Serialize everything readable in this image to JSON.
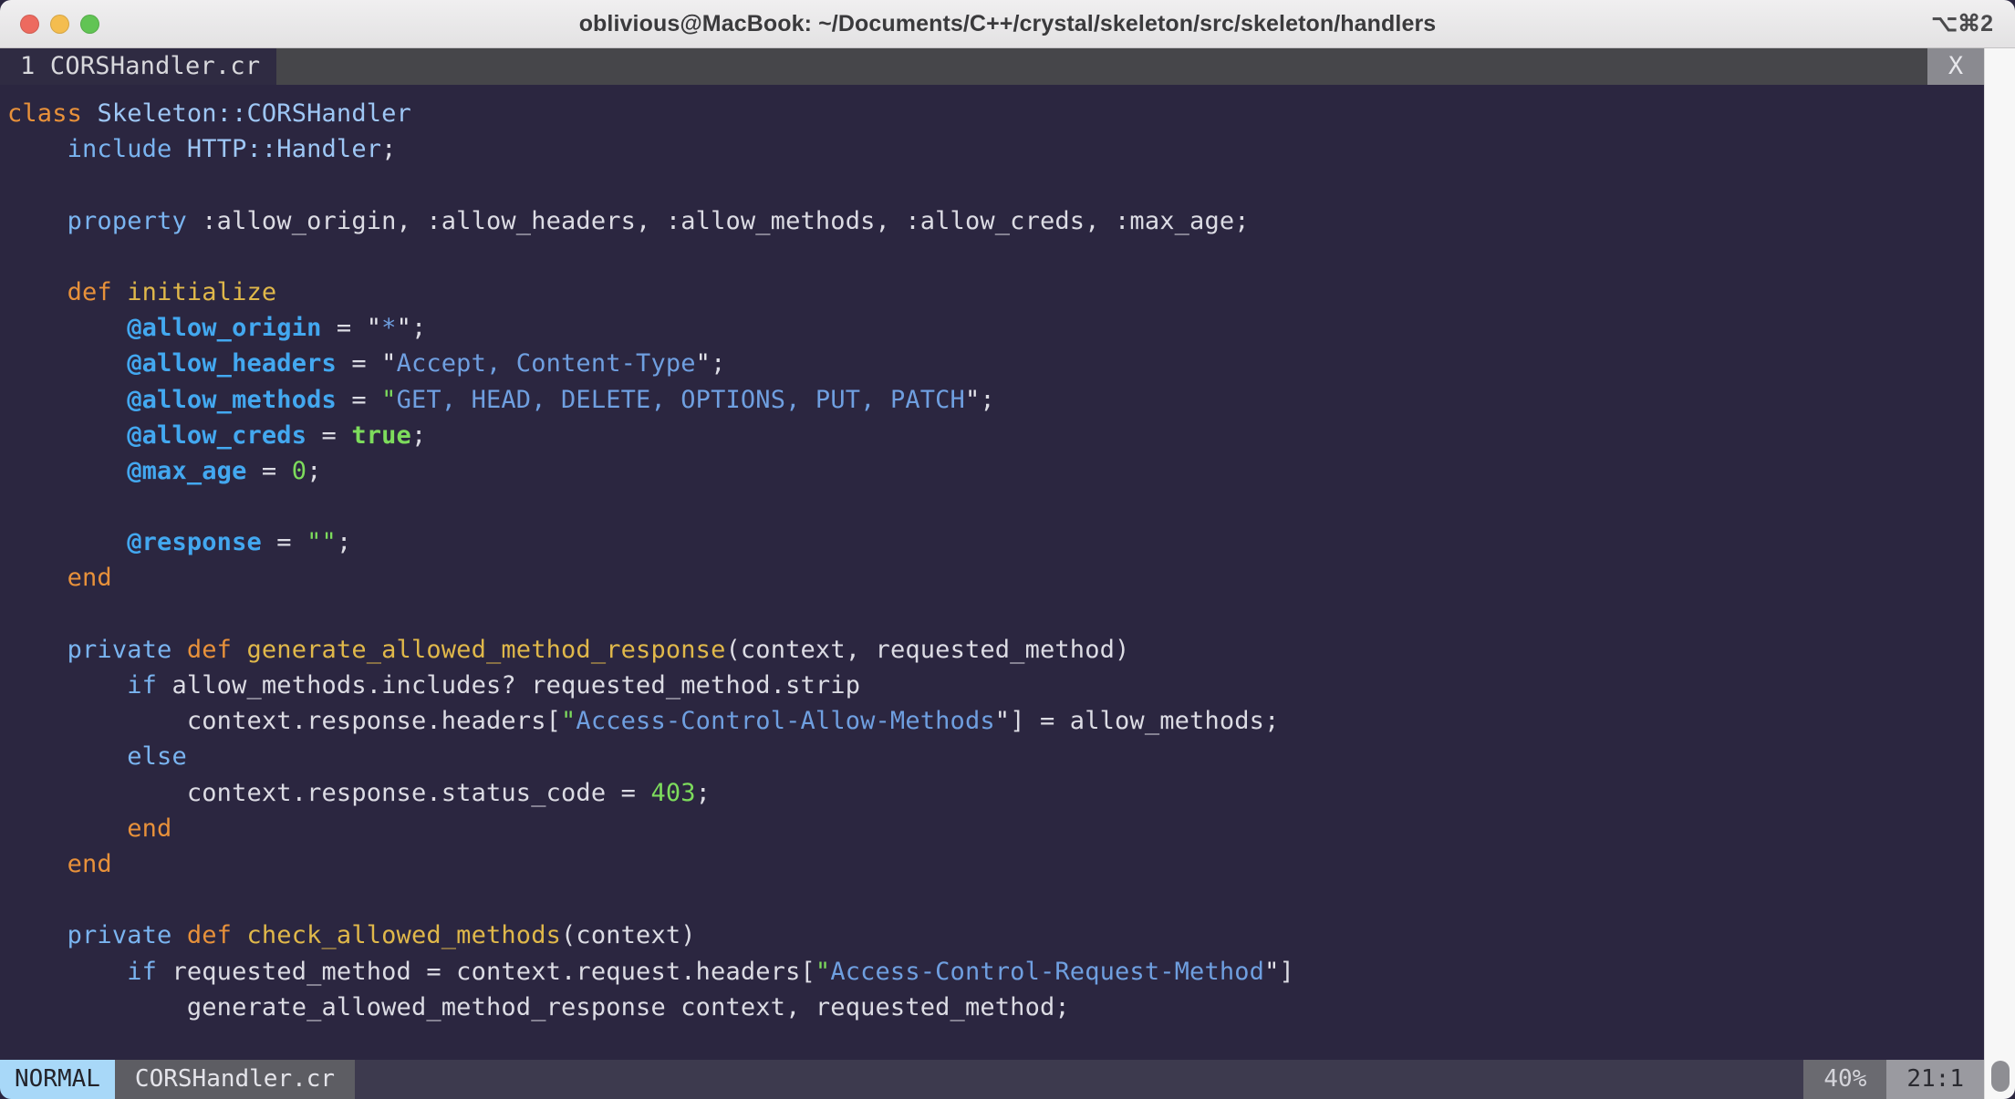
{
  "window": {
    "title": "oblivious@MacBook: ~/Documents/C++/crystal/skeleton/src/skeleton/handlers",
    "shortcut": "⌥⌘2",
    "traffic_lights": [
      "close",
      "minimize",
      "zoom"
    ]
  },
  "tabline": {
    "tabs": [
      {
        "label": "1 CORSHandler.cr"
      }
    ],
    "close_label": "X"
  },
  "statusbar": {
    "mode": "NORMAL",
    "file": "CORSHandler.cr",
    "percent": "40%",
    "position": "21:1"
  },
  "editor": {
    "language": "crystal",
    "lines": [
      [
        {
          "t": "class ",
          "c": "kw-orange"
        },
        {
          "t": "Skeleton::CORSHandler",
          "c": "typ"
        }
      ],
      [
        {
          "t": "    ",
          "c": "plain"
        },
        {
          "t": "include ",
          "c": "kw-blue"
        },
        {
          "t": "HTTP::Handler",
          "c": "typ"
        },
        {
          "t": ";",
          "c": "plain"
        }
      ],
      [],
      [
        {
          "t": "    ",
          "c": "plain"
        },
        {
          "t": "property",
          "c": "kw-blue"
        },
        {
          "t": " :allow_origin, :allow_headers, :allow_methods, :allow_creds, :max_age;",
          "c": "sym"
        }
      ],
      [],
      [
        {
          "t": "    ",
          "c": "plain"
        },
        {
          "t": "def ",
          "c": "kw-orange"
        },
        {
          "t": "initialize",
          "c": "fn"
        }
      ],
      [
        {
          "t": "        ",
          "c": "plain"
        },
        {
          "t": "@allow_origin",
          "c": "ivar"
        },
        {
          "t": " = ",
          "c": "plain"
        },
        {
          "t": "\"",
          "c": "q"
        },
        {
          "t": "*",
          "c": "str"
        },
        {
          "t": "\"",
          "c": "q"
        },
        {
          "t": ";",
          "c": "plain"
        }
      ],
      [
        {
          "t": "        ",
          "c": "plain"
        },
        {
          "t": "@allow_headers",
          "c": "ivar"
        },
        {
          "t": " = ",
          "c": "plain"
        },
        {
          "t": "\"",
          "c": "q"
        },
        {
          "t": "Accept, Content-Type",
          "c": "str"
        },
        {
          "t": "\"",
          "c": "q"
        },
        {
          "t": ";",
          "c": "plain"
        }
      ],
      [
        {
          "t": "        ",
          "c": "plain"
        },
        {
          "t": "@allow_methods",
          "c": "ivar"
        },
        {
          "t": " = ",
          "c": "plain"
        },
        {
          "t": "\"",
          "c": "qg"
        },
        {
          "t": "GET, HEAD, DELETE, OPTIONS, PUT, PATCH",
          "c": "str"
        },
        {
          "t": "\"",
          "c": "q"
        },
        {
          "t": ";",
          "c": "plain"
        }
      ],
      [
        {
          "t": "        ",
          "c": "plain"
        },
        {
          "t": "@allow_creds",
          "c": "ivar"
        },
        {
          "t": " = ",
          "c": "plain"
        },
        {
          "t": "true",
          "c": "bool"
        },
        {
          "t": ";",
          "c": "plain"
        }
      ],
      [
        {
          "t": "        ",
          "c": "plain"
        },
        {
          "t": "@max_age",
          "c": "ivar"
        },
        {
          "t": " = ",
          "c": "plain"
        },
        {
          "t": "0",
          "c": "num"
        },
        {
          "t": ";",
          "c": "plain"
        }
      ],
      [],
      [
        {
          "t": "        ",
          "c": "plain"
        },
        {
          "t": "@response",
          "c": "ivar"
        },
        {
          "t": " = ",
          "c": "plain"
        },
        {
          "t": "\"\"",
          "c": "qg"
        },
        {
          "t": ";",
          "c": "plain"
        }
      ],
      [
        {
          "t": "    ",
          "c": "plain"
        },
        {
          "t": "end",
          "c": "kw-orange"
        }
      ],
      [],
      [
        {
          "t": "    ",
          "c": "plain"
        },
        {
          "t": "private ",
          "c": "kw-blue"
        },
        {
          "t": "def ",
          "c": "kw-orange"
        },
        {
          "t": "generate_allowed_method_response",
          "c": "fn"
        },
        {
          "t": "(context, requested_method)",
          "c": "plain"
        }
      ],
      [
        {
          "t": "        ",
          "c": "plain"
        },
        {
          "t": "if",
          "c": "kw-blue"
        },
        {
          "t": " allow_methods.includes? requested_method.strip",
          "c": "plain"
        }
      ],
      [
        {
          "t": "            ",
          "c": "plain"
        },
        {
          "t": "context.response.headers[",
          "c": "plain"
        },
        {
          "t": "\"",
          "c": "qg"
        },
        {
          "t": "Access-Control-Allow-Methods",
          "c": "str"
        },
        {
          "t": "\"",
          "c": "q"
        },
        {
          "t": "] = allow_methods;",
          "c": "plain"
        }
      ],
      [
        {
          "t": "        ",
          "c": "plain"
        },
        {
          "t": "else",
          "c": "kw-blue"
        }
      ],
      [
        {
          "t": "            ",
          "c": "plain"
        },
        {
          "t": "context.response.status_code = ",
          "c": "plain"
        },
        {
          "t": "403",
          "c": "num"
        },
        {
          "t": ";",
          "c": "plain"
        }
      ],
      [
        {
          "t": "        ",
          "c": "plain"
        },
        {
          "t": "end",
          "c": "kw-orange"
        }
      ],
      [
        {
          "t": "    ",
          "c": "plain"
        },
        {
          "t": "end",
          "c": "kw-orange"
        }
      ],
      [],
      [
        {
          "t": "    ",
          "c": "plain"
        },
        {
          "t": "private ",
          "c": "kw-blue"
        },
        {
          "t": "def ",
          "c": "kw-orange"
        },
        {
          "t": "check_allowed_methods",
          "c": "fn"
        },
        {
          "t": "(context)",
          "c": "plain"
        }
      ],
      [
        {
          "t": "        ",
          "c": "plain"
        },
        {
          "t": "if",
          "c": "kw-blue"
        },
        {
          "t": " requested_method = context.request.headers[",
          "c": "plain"
        },
        {
          "t": "\"",
          "c": "qg"
        },
        {
          "t": "Access-Control-Request-Method",
          "c": "str"
        },
        {
          "t": "\"",
          "c": "q"
        },
        {
          "t": "]",
          "c": "plain"
        }
      ],
      [
        {
          "t": "            ",
          "c": "plain"
        },
        {
          "t": "generate_allowed_method_response context, requested_method;",
          "c": "plain"
        }
      ]
    ]
  },
  "colors": {
    "background": "#2b2640",
    "keyword_orange": "#e8913a",
    "keyword_blue": "#7ab4f0",
    "type": "#9ec7f5",
    "function": "#e0b84a",
    "ivar": "#43a8f0",
    "string": "#6f9fe0",
    "number_green": "#7ddc5c",
    "status_mode_bg": "#a8d8f8"
  }
}
